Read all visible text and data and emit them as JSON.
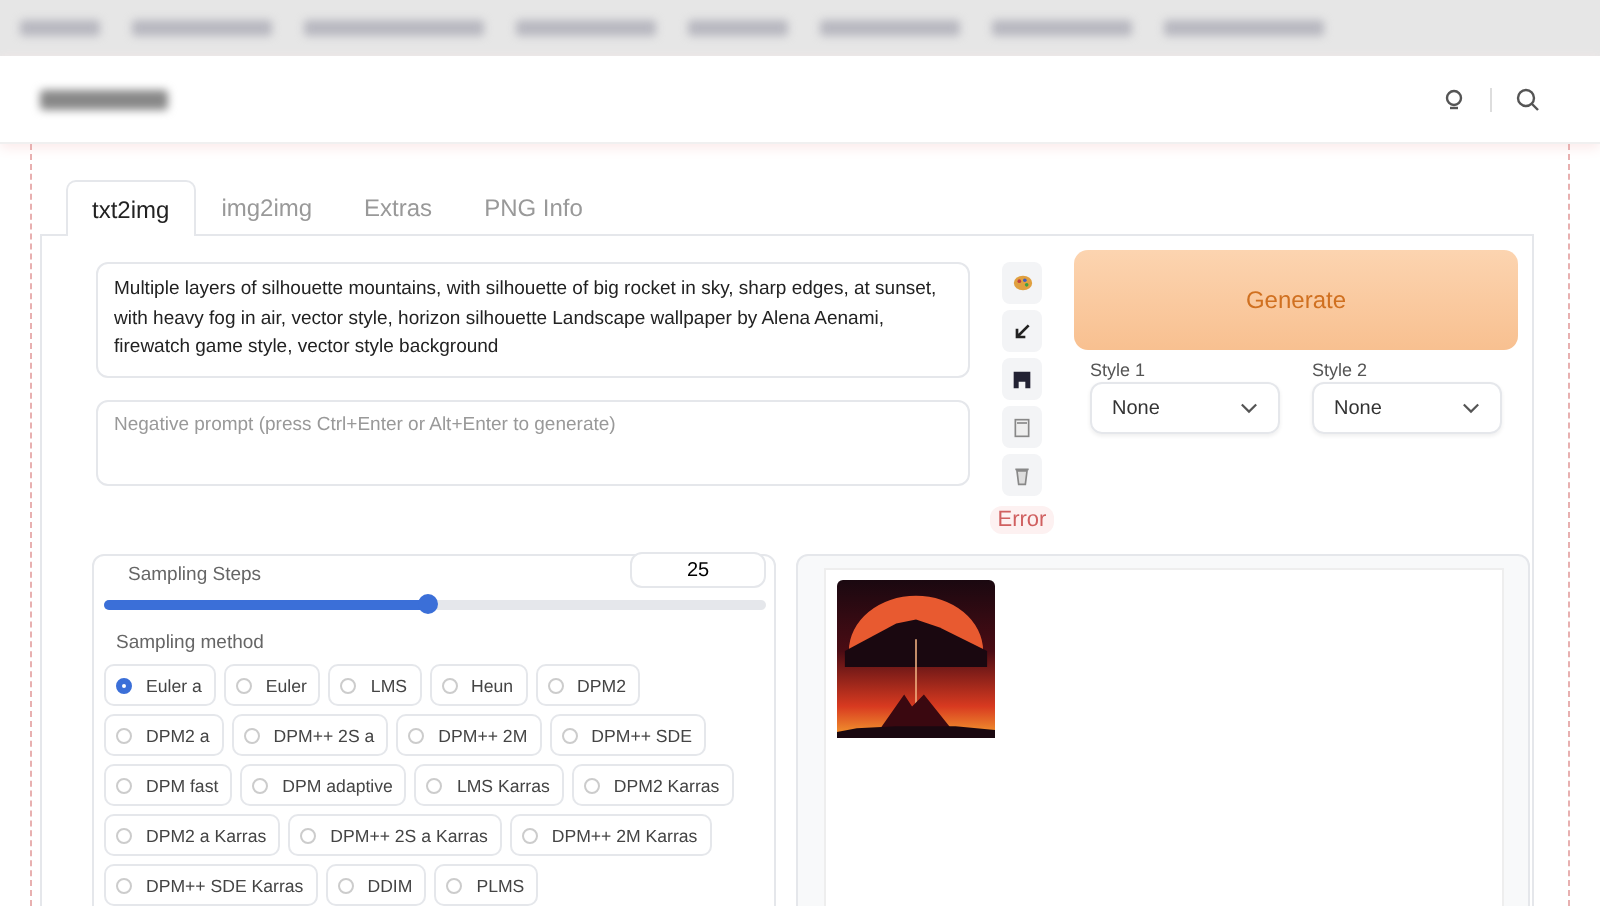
{
  "tabs": [
    {
      "label": "txt2img",
      "selected": true
    },
    {
      "label": "img2img",
      "selected": false
    },
    {
      "label": "Extras",
      "selected": false
    },
    {
      "label": "PNG Info",
      "selected": false
    }
  ],
  "prompt": {
    "value": "Multiple layers of silhouette mountains, with silhouette of big rocket in sky, sharp edges, at sunset, with heavy fog in air, vector style, horizon silhouette Landscape wallpaper by Alena Aenami, firewatch game style, vector style background"
  },
  "negative_prompt": {
    "placeholder": "Negative prompt (press Ctrl+Enter or Alt+Enter to generate)"
  },
  "status": "Error",
  "generate_button": "Generate",
  "styles": [
    {
      "label": "Style 1",
      "value": "None"
    },
    {
      "label": "Style 2",
      "value": "None"
    }
  ],
  "sampling_steps": {
    "label": "Sampling Steps",
    "value": "25",
    "level": 0.49
  },
  "sampling_method": {
    "label": "Sampling method",
    "options": [
      {
        "label": "Euler a",
        "selected": true
      },
      {
        "label": "Euler",
        "selected": false
      },
      {
        "label": "LMS",
        "selected": false
      },
      {
        "label": "Heun",
        "selected": false
      },
      {
        "label": "DPM2",
        "selected": false
      },
      {
        "label": "DPM2 a",
        "selected": false
      },
      {
        "label": "DPM++ 2S a",
        "selected": false
      },
      {
        "label": "DPM++ 2M",
        "selected": false
      },
      {
        "label": "DPM++ SDE",
        "selected": false
      },
      {
        "label": "DPM fast",
        "selected": false
      },
      {
        "label": "DPM adaptive",
        "selected": false
      },
      {
        "label": "LMS Karras",
        "selected": false
      },
      {
        "label": "DPM2 Karras",
        "selected": false
      },
      {
        "label": "DPM2 a Karras",
        "selected": false
      },
      {
        "label": "DPM++ 2S a Karras",
        "selected": false
      },
      {
        "label": "DPM++ 2M Karras",
        "selected": false
      },
      {
        "label": "DPM++ SDE Karras",
        "selected": false
      },
      {
        "label": "DDIM",
        "selected": false
      },
      {
        "label": "PLMS",
        "selected": false
      }
    ]
  }
}
